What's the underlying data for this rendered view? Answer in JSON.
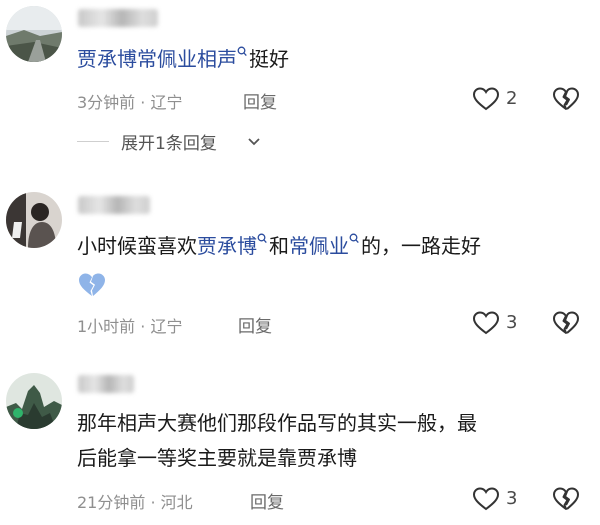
{
  "comments": [
    {
      "segments": [
        {
          "text": "贾承博",
          "highlight": true,
          "search_icon": false
        },
        {
          "text": "常佩业相声",
          "highlight": true,
          "search_icon": true
        },
        {
          "text": "挺好",
          "highlight": false,
          "search_icon": false
        }
      ],
      "meta": "3分钟前 · 辽宁",
      "reply_label": "回复",
      "likes": "2",
      "expand_label": "展开1条回复"
    },
    {
      "segments": [
        {
          "text": "小时候蛮喜欢",
          "highlight": false,
          "search_icon": false
        },
        {
          "text": "贾承博",
          "highlight": true,
          "search_icon": true
        },
        {
          "text": "和",
          "highlight": false,
          "search_icon": false
        },
        {
          "text": "常佩业",
          "highlight": true,
          "search_icon": true
        },
        {
          "text": "的，一路走好",
          "highlight": false,
          "search_icon": false
        }
      ],
      "emoji": "broken-heart-emoji",
      "meta": "1小时前 · 辽宁",
      "reply_label": "回复",
      "likes": "3"
    },
    {
      "lines": [
        "那年相声大赛他们那段作品写的其实一般，最",
        "后能拿一等奖主要就是靠贾承博"
      ],
      "meta": "21分钟前 · 河北",
      "reply_label": "回复",
      "likes": "3"
    }
  ],
  "colors": {
    "highlight": "#2b4c9e",
    "meta": "#8f8f8f",
    "emoji_heart": "#8fb4e8"
  },
  "icons": {
    "like": "heart-outline-icon",
    "dislike": "broken-heart-outline-icon",
    "expand": "chevron-down-icon",
    "search": "search-icon"
  }
}
